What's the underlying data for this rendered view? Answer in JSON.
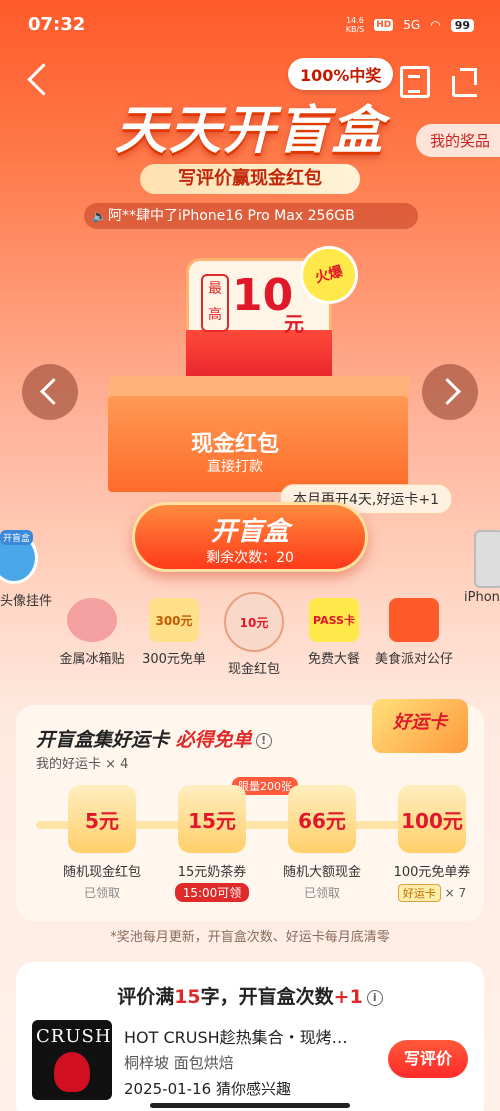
{
  "status_bar": {
    "time": "07:32",
    "net_speed": "14.6\nKB/S",
    "hd": "HD",
    "signal": "5G",
    "battery": "99"
  },
  "header": {
    "badge": "100%中奖",
    "title": "天天开盲盒",
    "my_prizes": "我的奖品",
    "subtitle": "写评价赢现金红包",
    "marquee": "阿**肆中了iPhone16 Pro Max 256GB"
  },
  "featured": {
    "max_label": "最高",
    "amount": "10",
    "unit": "元",
    "hot": "火爆",
    "box_title": "现金红包",
    "box_sub": "直接打款",
    "bubble": "本月再开4天,好运卡+1",
    "open_button": "开盲盒",
    "remaining": "剩余次数：20"
  },
  "side": {
    "left_tag": "开盲盒",
    "left_label": "头像挂件",
    "right_label": "iPhon"
  },
  "prizes": [
    {
      "name": "金属冰箱贴",
      "thumb": ""
    },
    {
      "name": "300元免单",
      "thumb": "300元"
    },
    {
      "name": "现金红包",
      "thumb": "10元"
    },
    {
      "name": "免费大餐",
      "thumb": "PASS卡"
    },
    {
      "name": "美食派对公仔",
      "thumb": ""
    }
  ],
  "lucky": {
    "title_prefix": "开盲盒集好运卡 ",
    "title_highlight": "必得免单",
    "my_cards": "我的好运卡 × 4",
    "badge": "好运卡",
    "limit_tag": "限量200张",
    "stages": [
      {
        "thumb": "5元",
        "name": "随机现金红包",
        "status": "已领取"
      },
      {
        "thumb": "15元",
        "name": "15元奶茶券",
        "badge": "15:00可领"
      },
      {
        "thumb": "66元",
        "name": "随机大额现金",
        "status": "已领取"
      },
      {
        "thumb": "100元",
        "name": "100元免单券",
        "card_tag": "好运卡",
        "times": "× 7"
      }
    ]
  },
  "notice": "*奖池每月更新，开盲盒次数、好运卡每月底清零",
  "review": {
    "title_prefix": "评价满",
    "title_num": "15",
    "title_mid": "字，开盲盒次数",
    "title_plus": "+1",
    "poster_text": "CRUSH",
    "shop_name": "HOT CRUSH趁热集合・现烤…",
    "shop_location": "桐梓坡  面包烘焙",
    "date": "2025-01-16  猜你感兴趣",
    "button": "写评价"
  }
}
